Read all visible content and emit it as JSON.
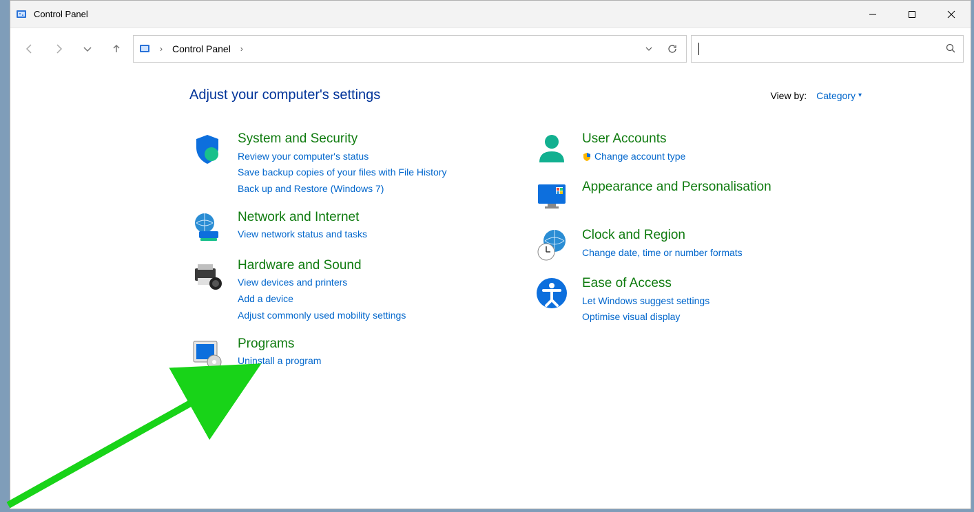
{
  "window": {
    "title": "Control Panel"
  },
  "breadcrumb": {
    "root": "Control Panel"
  },
  "search": {
    "placeholder": ""
  },
  "header": {
    "title": "Adjust your computer's settings",
    "viewby_label": "View by:",
    "viewby_value": "Category"
  },
  "left": [
    {
      "title": "System and Security",
      "links": [
        "Review your computer's status",
        "Save backup copies of your files with File History",
        "Back up and Restore (Windows 7)"
      ]
    },
    {
      "title": "Network and Internet",
      "links": [
        "View network status and tasks"
      ]
    },
    {
      "title": "Hardware and Sound",
      "links": [
        "View devices and printers",
        "Add a device",
        "Adjust commonly used mobility settings"
      ]
    },
    {
      "title": "Programs",
      "links": [
        "Uninstall a program"
      ]
    }
  ],
  "right": [
    {
      "title": "User Accounts",
      "links": [
        "Change account type"
      ],
      "shield": true
    },
    {
      "title": "Appearance and Personalisation",
      "links": []
    },
    {
      "title": "Clock and Region",
      "links": [
        "Change date, time or number formats"
      ]
    },
    {
      "title": "Ease of Access",
      "links": [
        "Let Windows suggest settings",
        "Optimise visual display"
      ]
    }
  ]
}
